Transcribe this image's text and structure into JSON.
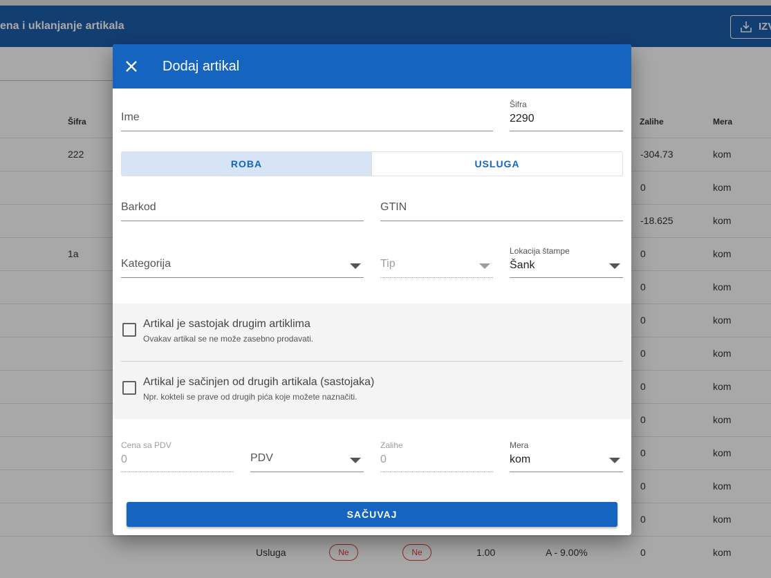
{
  "background": {
    "page_title": "ena i uklanjanje artikala",
    "export_label": "IZV",
    "columns": {
      "sifra": "Šifra",
      "zalihe": "Zalihe",
      "mera": "Mera"
    },
    "rows": [
      {
        "sifra": "222",
        "zalihe": "-304.73",
        "mera": "kom"
      },
      {
        "sifra": "",
        "zalihe": "0",
        "mera": "kom"
      },
      {
        "sifra": "",
        "zalihe": "-18.625",
        "mera": "kom"
      },
      {
        "sifra": "1a",
        "zalihe": "0",
        "mera": "kom"
      },
      {
        "sifra": "",
        "zalihe": "0",
        "mera": "kom"
      },
      {
        "sifra": "",
        "zalihe": "0",
        "mera": "kom"
      },
      {
        "sifra": "",
        "zalihe": "0",
        "mera": "kom"
      },
      {
        "sifra": "",
        "zalihe": "0",
        "mera": "kom"
      },
      {
        "sifra": "",
        "zalihe": "0",
        "mera": "kom"
      },
      {
        "sifra": "",
        "zalihe": "0",
        "mera": "kom"
      },
      {
        "sifra": "",
        "zalihe": "0",
        "mera": "kom"
      },
      {
        "sifra": "",
        "zalihe": "0",
        "mera": "kom"
      }
    ],
    "last_row": {
      "tip": "Usluga",
      "pill1": "Ne",
      "pill2": "Ne",
      "kolicina": "1.00",
      "pdv": "A - 9.00%",
      "zalihe": "0",
      "mera": "kom"
    }
  },
  "dialog": {
    "title": "Dodaj artikal",
    "ime": {
      "label": "Ime",
      "value": ""
    },
    "sifra": {
      "label": "Šifra",
      "value": "2290"
    },
    "type_toggle": {
      "goods": "ROBA",
      "service": "USLUGA",
      "selected": "ROBA"
    },
    "barkod": {
      "label": "Barkod"
    },
    "gtin": {
      "label": "GTIN"
    },
    "kategorija": {
      "label": "Kategorija"
    },
    "tip": {
      "label": "Tip"
    },
    "lokacija": {
      "label": "Lokacija štampe",
      "value": "Šank"
    },
    "ingredient_check": {
      "title": "Artikal je sastojak drugim artiklima",
      "subtitle": "Ovakav artikal se ne može zasebno prodavati.",
      "checked": false
    },
    "composite_check": {
      "title": "Artikal je sačinjen od drugih artikala (sastojaka)",
      "subtitle": "Npr. kokteli se prave od drugih pića koje možete naznačiti.",
      "checked": false
    },
    "cena": {
      "label": "Cena sa PDV",
      "value": "0"
    },
    "pdv": {
      "label": "PDV"
    },
    "zalihe": {
      "label": "Zalihe",
      "value": "0"
    },
    "mera": {
      "label": "Mera",
      "value": "kom"
    },
    "save_label": "SAČUVAJ"
  },
  "colors": {
    "primary": "#1565c0",
    "appbar": "#1e5fae",
    "toggle_selected": "#d6e4f5",
    "pill": "#e53935"
  }
}
